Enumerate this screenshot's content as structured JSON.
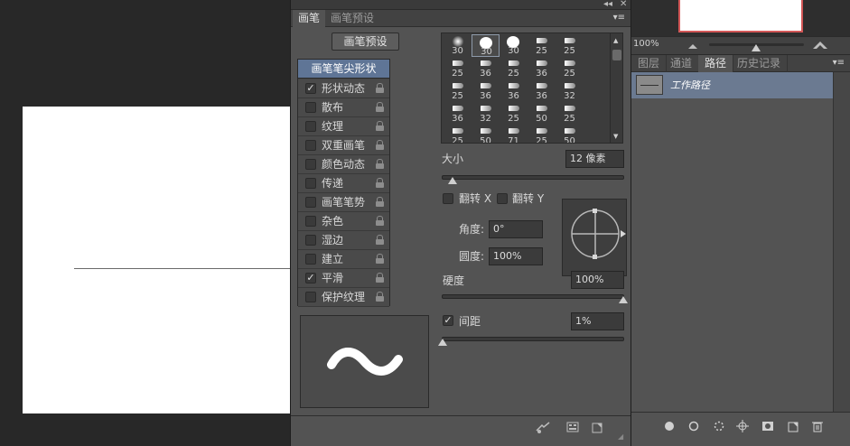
{
  "brush_panel": {
    "tabs": [
      "画笔",
      "画笔预设"
    ],
    "collapse_glyph": "◂◂",
    "close_glyph": "✕",
    "menu_glyph": "▾≡",
    "preset_button": "画笔预设",
    "options_header": "画笔笔尖形状",
    "options": [
      {
        "label": "形状动态",
        "checked": true
      },
      {
        "label": "散布",
        "checked": false
      },
      {
        "label": "纹理",
        "checked": false
      },
      {
        "label": "双重画笔",
        "checked": false
      },
      {
        "label": "颜色动态",
        "checked": false
      },
      {
        "label": "传递",
        "checked": false
      },
      {
        "label": "画笔笔势",
        "checked": false
      },
      {
        "label": "杂色",
        "checked": false
      },
      {
        "label": "湿边",
        "checked": false
      },
      {
        "label": "建立",
        "checked": false
      },
      {
        "label": "平滑",
        "checked": true
      },
      {
        "label": "保护纹理",
        "checked": false
      }
    ],
    "brush_sizes": [
      [
        "30",
        "30",
        "30",
        "25",
        "25"
      ],
      [
        "25",
        "36",
        "25",
        "36",
        "25"
      ],
      [
        "25",
        "36",
        "36",
        "36",
        "32"
      ],
      [
        "36",
        "32",
        "25",
        "50",
        "25"
      ],
      [
        "25",
        "50",
        "71",
        "25",
        "50"
      ]
    ],
    "size_label": "大小",
    "size_value": "12 像素",
    "flip_x_label": "翻转 X",
    "flip_y_label": "翻转 Y",
    "angle_label": "角度:",
    "angle_value": "0°",
    "roundness_label": "圆度:",
    "roundness_value": "100%",
    "hardness_label": "硬度",
    "hardness_value": "100%",
    "spacing_label": "间距",
    "spacing_value": "1%",
    "spacing_checked": true,
    "slider_levels": {
      "size": 0.06,
      "hardness": 1.0,
      "spacing": 0.01
    }
  },
  "right_panel": {
    "zoom": "100%",
    "tabs": [
      "图层",
      "通道",
      "路径",
      "历史记录"
    ],
    "active_tab": "路径",
    "menu_glyph": "▾≡",
    "path_name": "工作路径"
  },
  "colors": {
    "panel_bg": "#535353",
    "selected_row": "#6b7a91",
    "option_header": "#5f7596",
    "nav_frame": "#d35757"
  }
}
